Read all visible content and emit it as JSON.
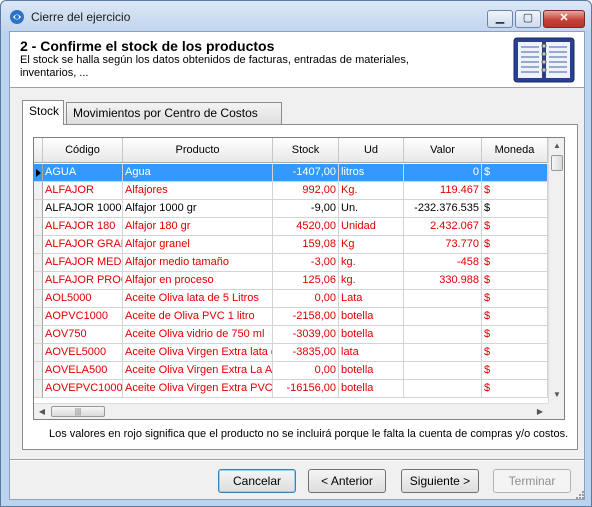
{
  "window": {
    "title": "Cierre del ejercicio",
    "minimize": "▁",
    "maximize": "▢",
    "close": "✕"
  },
  "header": {
    "step_title": "2 - Confirme el stock de los productos",
    "description": "El stock se halla según los datos obtenidos de facturas, entradas de materiales, inventarios, ..."
  },
  "tabs": [
    {
      "label": "Stock",
      "active": true
    },
    {
      "label": "Movimientos por Centro de Costos",
      "active": false
    }
  ],
  "grid": {
    "columns": [
      "Código",
      "Producto",
      "Stock",
      "Ud",
      "Valor",
      "Moneda"
    ],
    "rows": [
      {
        "codigo": "AGUA",
        "producto": "Agua",
        "stock": "-1407,00",
        "ud": "litros",
        "valor": "0",
        "moneda": "$",
        "color": "selected"
      },
      {
        "codigo": "ALFAJOR",
        "producto": "Alfajores",
        "stock": "992,00",
        "ud": "Kg.",
        "valor": "119.467",
        "moneda": "$",
        "color": "red"
      },
      {
        "codigo": "ALFAJOR 1000",
        "producto": "Alfajor 1000 gr",
        "stock": "-9,00",
        "ud": "Un.",
        "valor": "-232.376.535",
        "moneda": "$",
        "color": "black"
      },
      {
        "codigo": "ALFAJOR 180",
        "producto": "Alfajor 180 gr",
        "stock": "4520,00",
        "ud": "Unidad",
        "valor": "2.432.067",
        "moneda": "$",
        "color": "red"
      },
      {
        "codigo": "ALFAJOR GRAN",
        "producto": "Alfajor granel",
        "stock": "159,08",
        "ud": "Kg",
        "valor": "73.770",
        "moneda": "$",
        "color": "red"
      },
      {
        "codigo": "ALFAJOR MEDIO",
        "producto": "Alfajor medio tamaño",
        "stock": "-3,00",
        "ud": "kg.",
        "valor": "-458",
        "moneda": "$",
        "color": "red"
      },
      {
        "codigo": "ALFAJOR PROC",
        "producto": "Alfajor en proceso",
        "stock": "125,06",
        "ud": "kg.",
        "valor": "330.988",
        "moneda": "$",
        "color": "red"
      },
      {
        "codigo": "AOL5000",
        "producto": "Aceite Oliva  lata de 5 Litros",
        "stock": "0,00",
        "ud": "Lata",
        "valor": "",
        "moneda": "$",
        "color": "red"
      },
      {
        "codigo": "AOPVC1000",
        "producto": "Aceite de Oliva PVC 1 litro",
        "stock": "-2158,00",
        "ud": "botella",
        "valor": "",
        "moneda": "$",
        "color": "red"
      },
      {
        "codigo": "AOV750",
        "producto": "Aceite Oliva vidrio de 750 ml",
        "stock": "-3039,00",
        "ud": "botella",
        "valor": "",
        "moneda": "$",
        "color": "red"
      },
      {
        "codigo": "AOVEL5000",
        "producto": "Aceite Oliva Virgen Extra  lata de",
        "stock": "-3835,00",
        "ud": "lata",
        "valor": "",
        "moneda": "$",
        "color": "red"
      },
      {
        "codigo": "AOVELA500",
        "producto": "Aceite Oliva Virgen Extra  La Aca",
        "stock": "0,00",
        "ud": "botella",
        "valor": "",
        "moneda": "$",
        "color": "red"
      },
      {
        "codigo": "AOVEPVC1000",
        "producto": "Aceite Oliva Virgen Extra PVC",
        "stock": "-16156,00",
        "ud": "botella",
        "valor": "",
        "moneda": "$",
        "color": "red"
      }
    ]
  },
  "scrollbar": {
    "up": "▲",
    "down": "▼",
    "left": "◀",
    "right": "▶",
    "grip": "|||"
  },
  "note": "Los valores en rojo significa que el producto no se incluirá porque le falta la cuenta de compras y/o costos.",
  "buttons": {
    "cancel": "Cancelar",
    "back": "< Anterior",
    "next": "Siguiente >",
    "finish": "Terminar"
  },
  "colors": {
    "error_red": "#e00000",
    "selection": "#3399ff",
    "title_bar": "#c2d6ee"
  }
}
